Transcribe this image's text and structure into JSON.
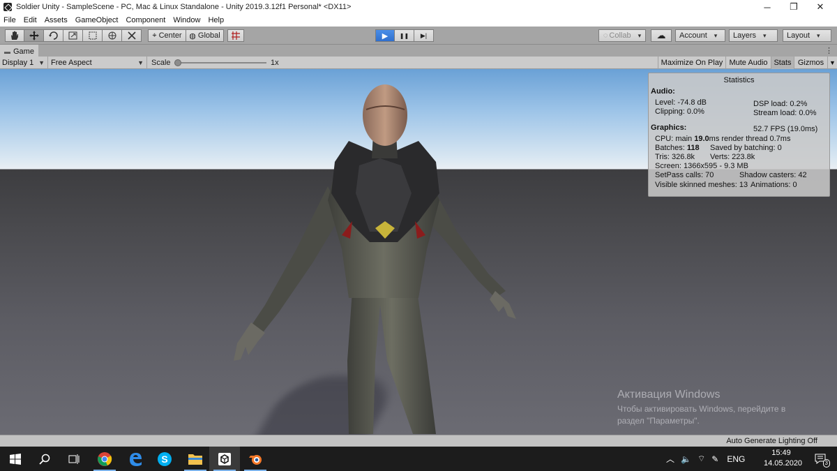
{
  "window": {
    "title": "Soldier Unity - SampleScene - PC, Mac & Linux Standalone - Unity 2019.3.12f1 Personal* <DX11>",
    "minimize_glyph": "─",
    "maximize_glyph": "❐",
    "close_glyph": "✕"
  },
  "menu": [
    "File",
    "Edit",
    "Assets",
    "GameObject",
    "Component",
    "Window",
    "Help"
  ],
  "toolbar": {
    "tools": [
      "hand-tool-icon",
      "move-tool-icon",
      "rotate-tool-icon",
      "scale-tool-icon",
      "rect-tool-icon",
      "transform-tool-icon",
      "custom-tool-icon"
    ],
    "pivot_label": "Center",
    "space_label": "Global",
    "play_glyph": "▶",
    "pause_glyph": "❚❚",
    "step_glyph": "▶|",
    "collab_label": "Collab",
    "cloud_glyph": "☁",
    "account_label": "Account",
    "layers_label": "Layers",
    "layout_label": "Layout"
  },
  "game_tab": {
    "label": "Game",
    "menu_glyph": "⋮"
  },
  "game_view_bar": {
    "display": "Display 1",
    "aspect": "Free Aspect",
    "scale_label": "Scale",
    "scale_value": "1x",
    "maximize_on_play": "Maximize On Play",
    "mute_audio": "Mute Audio",
    "stats": "Stats",
    "gizmos": "Gizmos"
  },
  "stats": {
    "title": "Statistics",
    "audio_header": "Audio:",
    "level": "Level: -74.8 dB",
    "dsp_load": "DSP load: 0.2%",
    "clipping": "Clipping: 0.0%",
    "stream_load": "Stream load: 0.0%",
    "graphics_header": "Graphics:",
    "fps": "52.7 FPS (19.0ms)",
    "cpu_prefix": "CPU: main ",
    "cpu_main": "19.0",
    "cpu_suffix": "ms  render thread 0.7ms",
    "batches_prefix": "Batches: ",
    "batches": "118",
    "saved_batching": "Saved by batching: 0",
    "tris": "Tris: 326.8k",
    "verts": "Verts: 223.8k",
    "screen": "Screen: 1366x595 - 9.3 MB",
    "setpass": "SetPass calls: 70",
    "shadow_casters": "Shadow casters: 42",
    "skinned_meshes": "Visible skinned meshes: 13",
    "animations": "Animations: 0"
  },
  "watermark": {
    "line1": "Активация Windows",
    "line2": "Чтобы активировать Windows, перейдите в",
    "line3": "раздел \"Параметры\"."
  },
  "status": {
    "lighting": "Auto Generate Lighting Off"
  },
  "taskbar": {
    "apps": [
      "windows-start-icon",
      "search-icon",
      "task-view-icon",
      "chrome-icon",
      "edge-icon",
      "skype-icon",
      "file-explorer-icon",
      "unity-icon",
      "blender-icon"
    ],
    "language": "ENG",
    "time": "15:49",
    "date": "14.05.2020",
    "notification_count": "3"
  },
  "colors": {
    "play_blue": "#3a7bd8",
    "toolbar_gray": "#a5a5a5",
    "taskbar": "#1c1c1c"
  }
}
